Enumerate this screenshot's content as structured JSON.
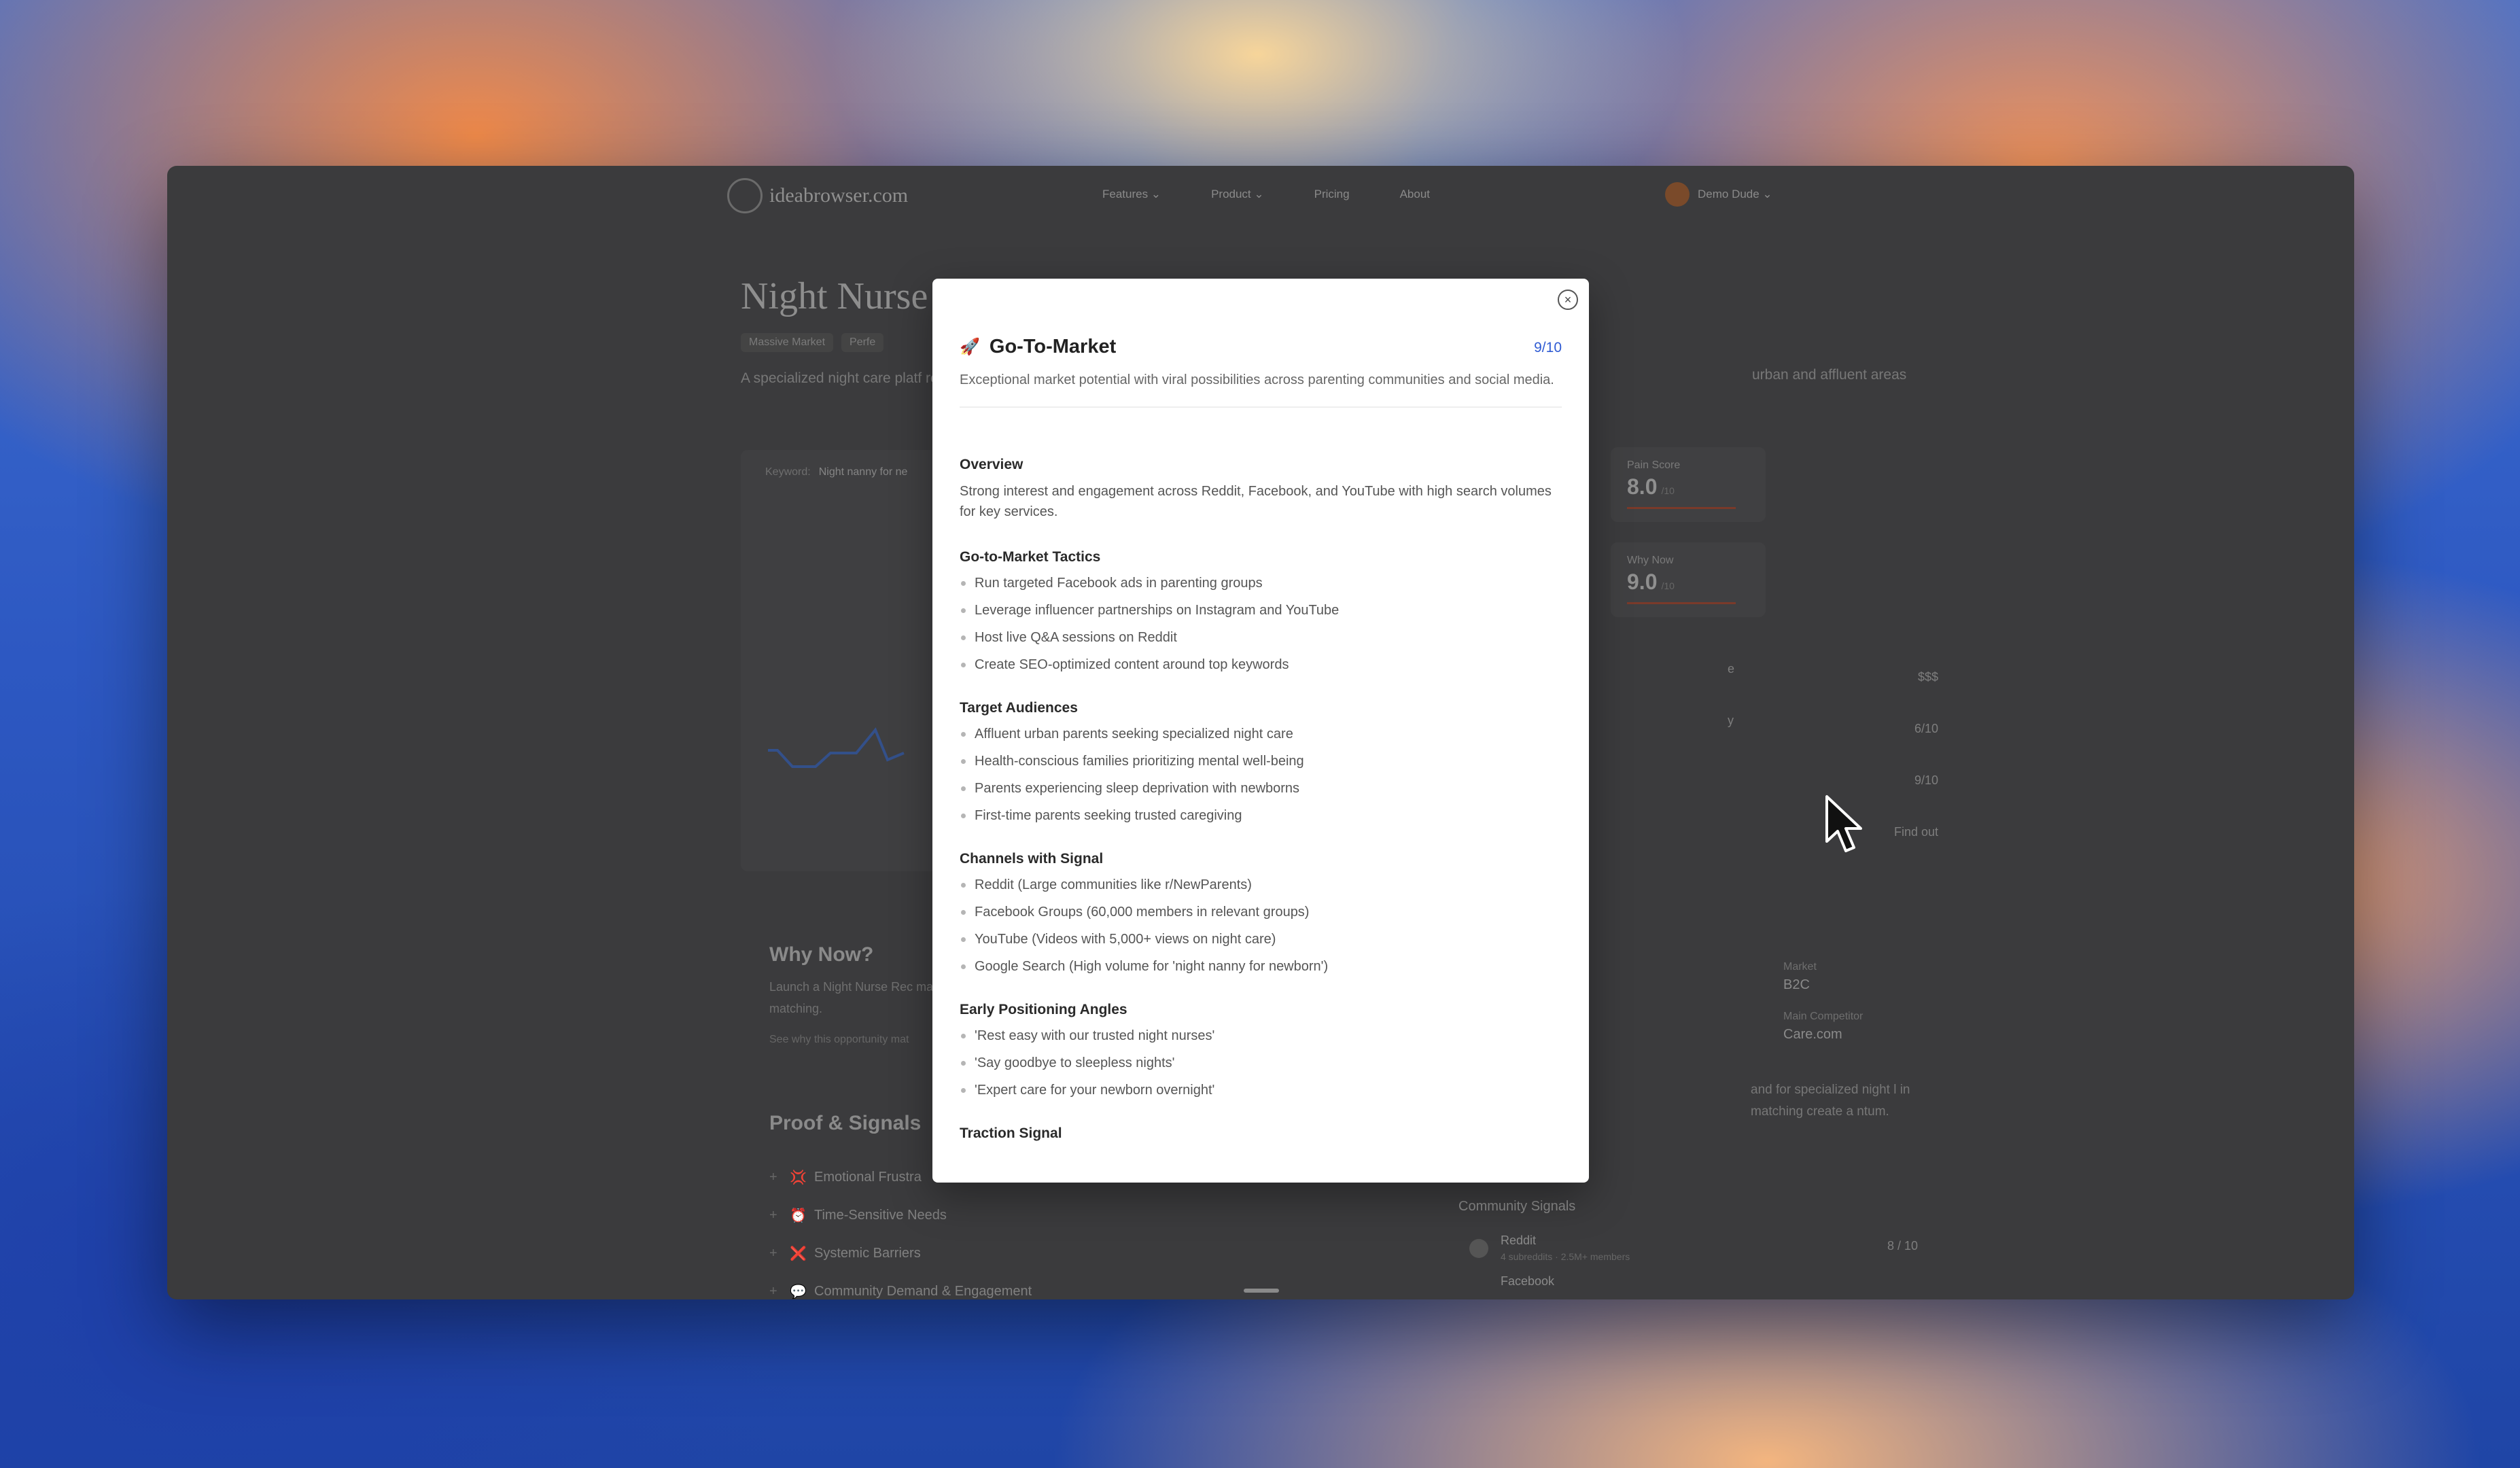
{
  "nav": {
    "logo_text": "ideabrowser.com",
    "links": [
      "Features ⌄",
      "Product ⌄",
      "Pricing",
      "About"
    ],
    "user_name": "Demo Dude ⌄"
  },
  "background": {
    "title": "Night Nurse Re",
    "badges": [
      "Massive Market",
      "Perfe"
    ],
    "description": "A specialized night care platf reliable overnight relief, dist",
    "description_right": "urban and affluent areas",
    "chart_keyword_label": "Keyword:",
    "chart_keyword_value": "Night nanny for ne",
    "scores": [
      {
        "label": "Pain Score",
        "value": "8.0",
        "suffix": "/10"
      },
      {
        "label": "Why Now",
        "value": "9.0",
        "suffix": "/10"
      }
    ],
    "right_list": [
      {
        "label": "e",
        "value": "$$$"
      },
      {
        "label": "y",
        "value": "6/10"
      },
      {
        "label": "",
        "value": "9/10"
      },
      {
        "label": "",
        "value": "Find out"
      }
    ],
    "why_now_title": "Why Now?",
    "why_now_text": "Launch a Night Nurse Rec market, driven by rising de advances in AI matching.",
    "why_now_link": "See why this opportunity mat",
    "proof_title": "Proof & Signals",
    "proof_items": [
      {
        "icon": "💢",
        "label": "Emotional Frustra"
      },
      {
        "icon": "⏰",
        "label": "Time-Sensitive Needs"
      },
      {
        "icon": "❌",
        "label": "Systemic Barriers"
      },
      {
        "icon": "💬",
        "label": "Community Demand & Engagement"
      }
    ],
    "market_label": "Market",
    "market_value": "B2C",
    "competitor_label": "Main Competitor",
    "competitor_value": "Care.com",
    "right_para": "and for specialized night l in matching create a ntum.",
    "community_title": "Community Signals",
    "community": [
      {
        "name": "Reddit",
        "sub": "4 subreddits · 2.5M+ members",
        "score": "8 / 10"
      },
      {
        "name": "Facebook",
        "sub": "",
        "score": ""
      }
    ]
  },
  "modal": {
    "icon": "rocket-icon",
    "title": "Go-To-Market",
    "score": "9/10",
    "subtitle": "Exceptional market potential with viral possibilities across parenting communities and social media.",
    "overview_title": "Overview",
    "overview_text": "Strong interest and engagement across Reddit, Facebook, and YouTube with high search volumes for key services.",
    "sections": [
      {
        "title": "Go-to-Market Tactics",
        "items": [
          "Run targeted Facebook ads in parenting groups",
          "Leverage influencer partnerships on Instagram and YouTube",
          "Host live Q&A sessions on Reddit",
          "Create SEO-optimized content around top keywords"
        ]
      },
      {
        "title": "Target Audiences",
        "items": [
          "Affluent urban parents seeking specialized night care",
          "Health-conscious families prioritizing mental well-being",
          "Parents experiencing sleep deprivation with newborns",
          "First-time parents seeking trusted caregiving"
        ]
      },
      {
        "title": "Channels with Signal",
        "items": [
          "Reddit (Large communities like r/NewParents)",
          "Facebook Groups (60,000 members in relevant groups)",
          "YouTube (Videos with 5,000+ views on night care)",
          "Google Search (High volume for 'night nanny for newborn')"
        ]
      },
      {
        "title": "Early Positioning Angles",
        "items": [
          "'Rest easy with our trusted night nurses'",
          "'Say goodbye to sleepless nights'",
          "'Expert care for your newborn overnight'"
        ]
      },
      {
        "title": "Traction Signal",
        "items": []
      }
    ]
  }
}
